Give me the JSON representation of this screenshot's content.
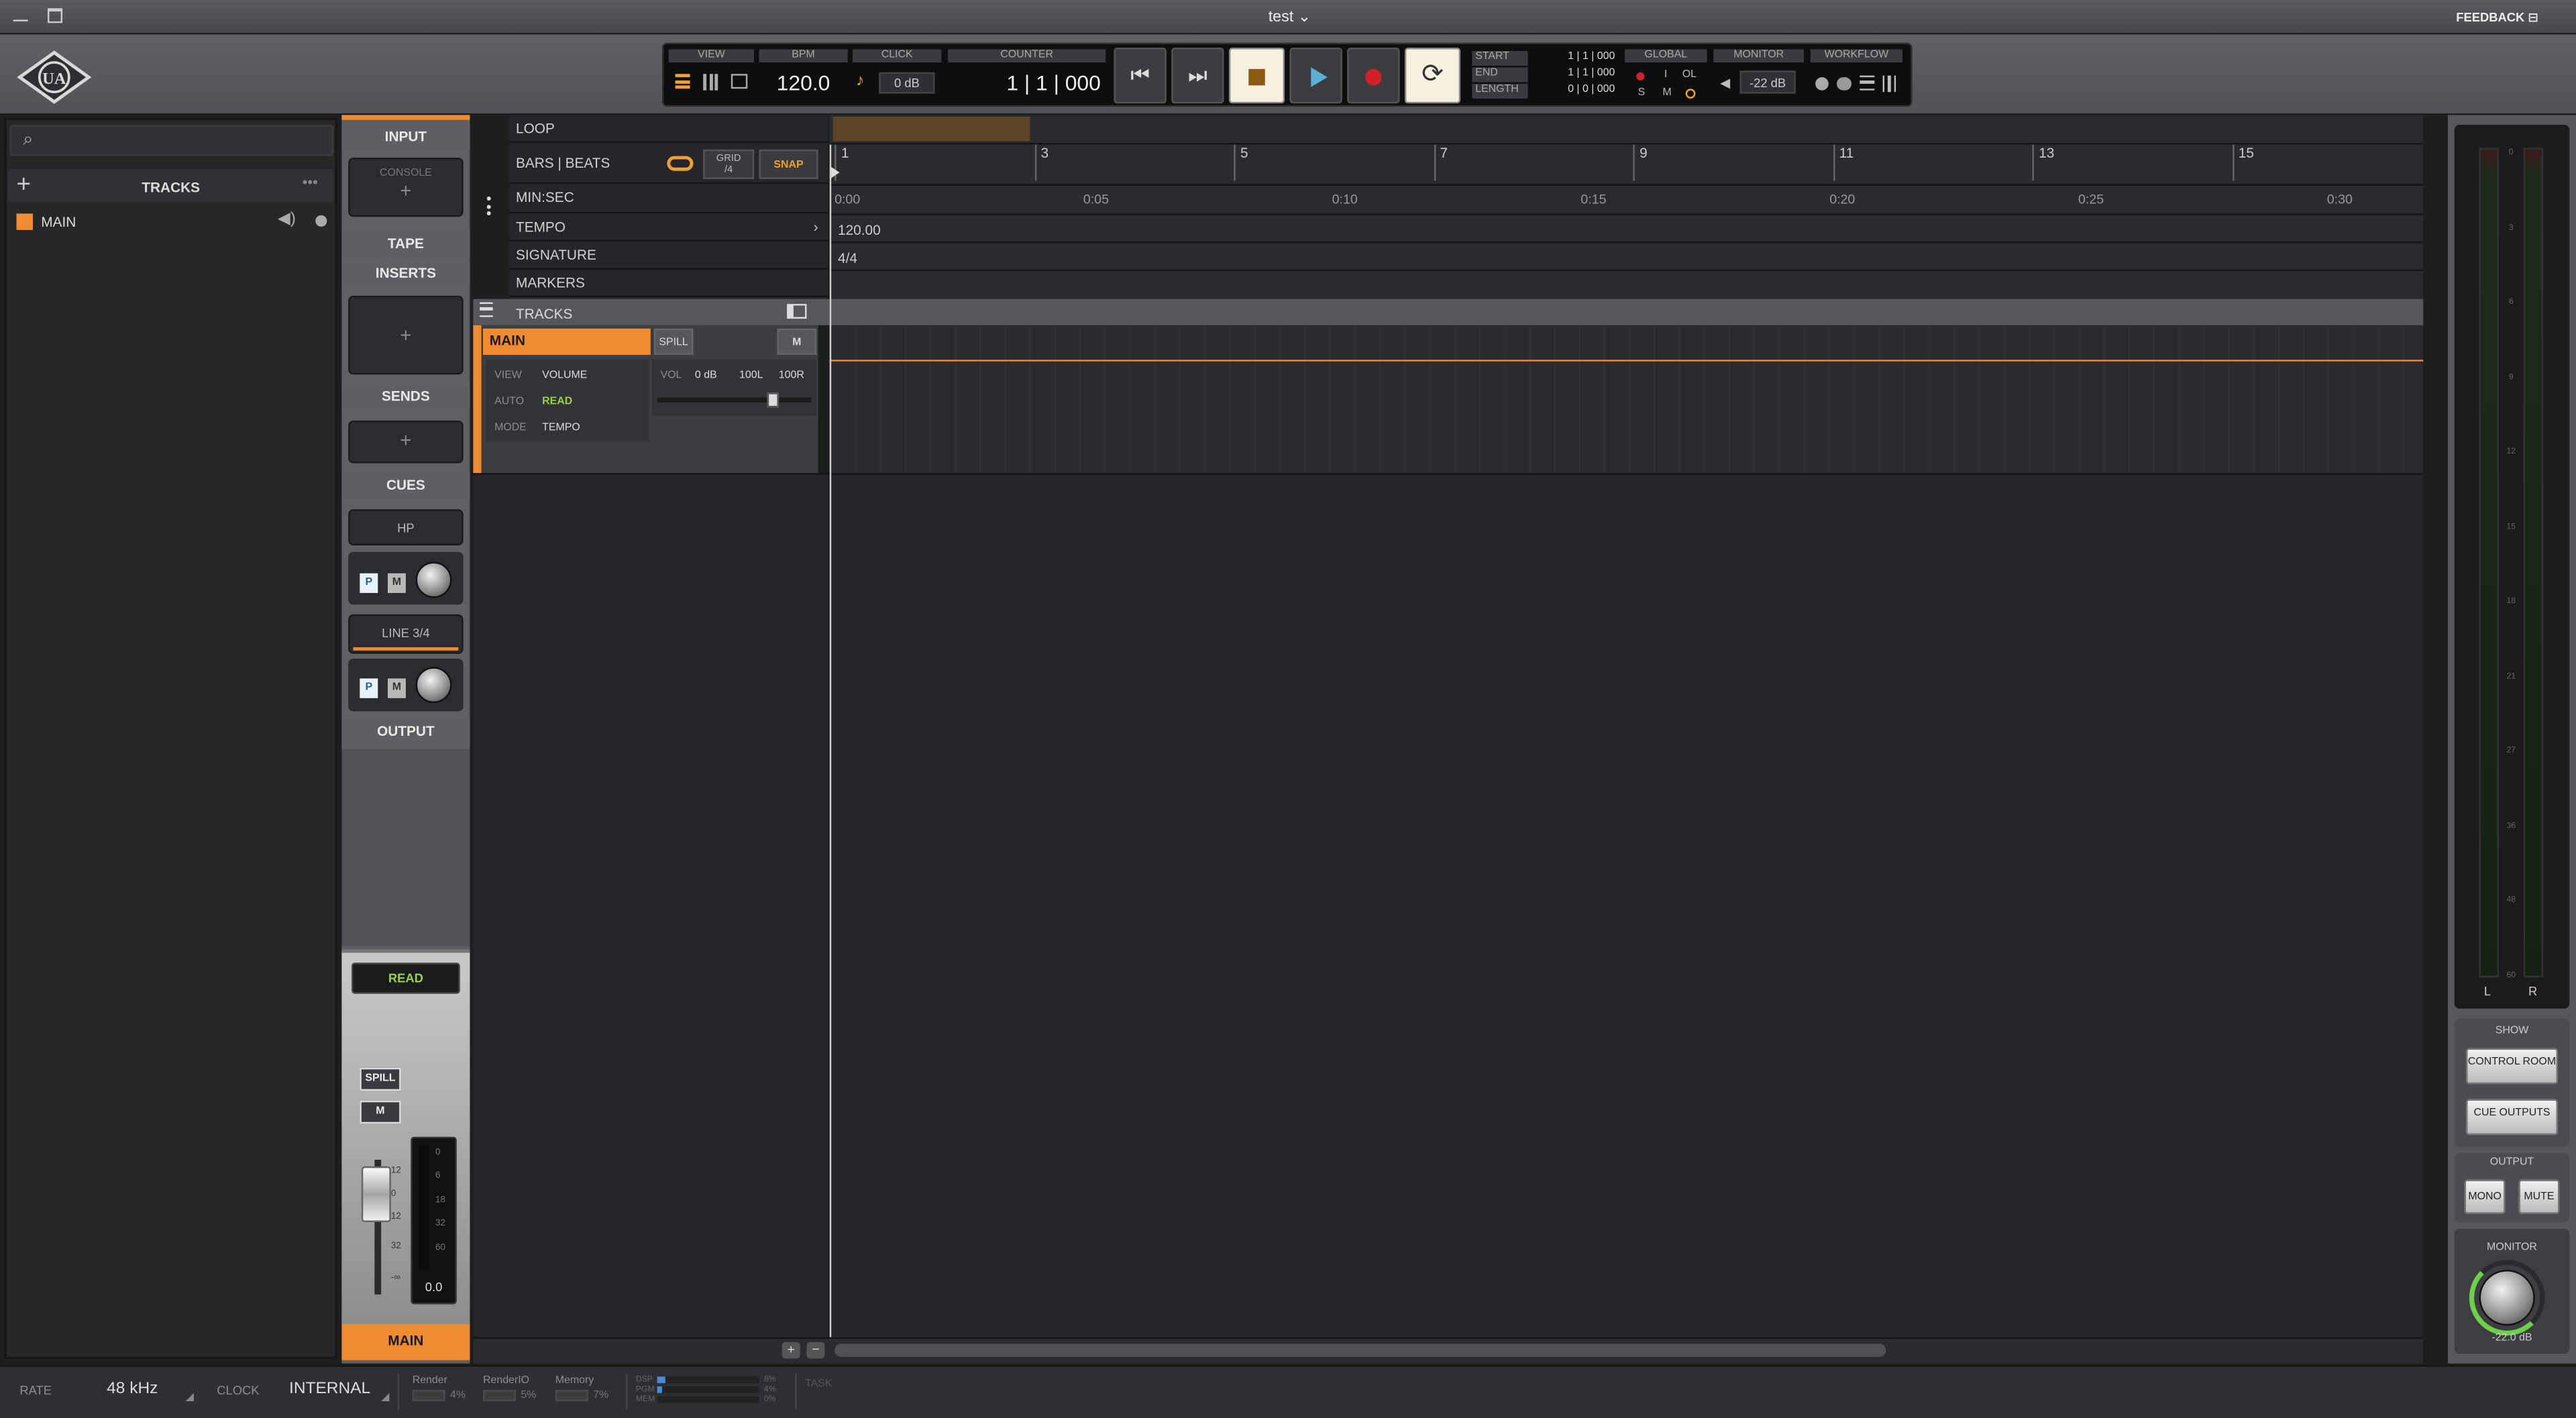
{
  "window": {
    "title": "test",
    "feedback": "FEEDBACK"
  },
  "colors": {
    "accent": "#f08a33",
    "green": "#9dd04a",
    "panel": "#5e6064"
  },
  "transport": {
    "view": "VIEW",
    "bpm_label": "BPM",
    "bpm": "120.0",
    "click_label": "CLICK",
    "click_value": "0 dB",
    "counter_label": "COUNTER",
    "counter": "1 | 1 | 000",
    "start_label": "START",
    "end_label": "END",
    "length_label": "LENGTH",
    "start": "1 | 1 | 000",
    "end": "1 | 1 | 000",
    "length": "0 | 0 | 000",
    "global_label": "GLOBAL",
    "global_i": "I",
    "global_ol": "OL",
    "global_s": "S",
    "global_m": "M",
    "monitor_label": "MONITOR",
    "monitor_value": "-22 dB",
    "workflow_label": "WORKFLOW"
  },
  "tracks_panel": {
    "header": "TRACKS",
    "items": [
      {
        "name": "MAIN"
      }
    ]
  },
  "channel_strip": {
    "input": "INPUT",
    "console": "CONSOLE",
    "tape": "TAPE",
    "inserts": "INSERTS",
    "sends": "SENDS",
    "cues": "CUES",
    "cue1": "HP",
    "cue2": "LINE 3/4",
    "p": "P",
    "m": "M",
    "output": "OUTPUT",
    "auto": "READ",
    "spill": "SPILL",
    "mute": "M",
    "fader_value": "0.0",
    "name": "MAIN",
    "scale": [
      "12",
      "0",
      "12",
      "32",
      "-∞"
    ],
    "meter_scale": [
      "0",
      "6",
      "18",
      "32",
      "60"
    ]
  },
  "rulers": {
    "loop": "LOOP",
    "bars_beats": "BARS | BEATS",
    "grid_label": "GRID",
    "grid_value": "/4",
    "snap": "SNAP",
    "min_sec": "MIN:SEC",
    "tempo": "TEMPO",
    "tempo_value": "120.00",
    "signature": "SIGNATURE",
    "signature_value": "4/4",
    "markers": "MARKERS",
    "tracks": "TRACKS",
    "bars": [
      "1",
      "3",
      "5",
      "7",
      "9",
      "11",
      "13",
      "15"
    ],
    "times": [
      "0:00",
      "0:05",
      "0:10",
      "0:15",
      "0:20",
      "0:25",
      "0:30"
    ]
  },
  "track": {
    "name": "MAIN",
    "spill": "SPILL",
    "mute": "M",
    "view_label": "VIEW",
    "view_value": "VOLUME",
    "auto_label": "AUTO",
    "auto_value": "READ",
    "mode_label": "MODE",
    "mode_value": "TEMPO",
    "vol_label": "VOL",
    "vol_value": "0 dB",
    "pan_l": "100L",
    "pan_r": "100R"
  },
  "right_panel": {
    "meter_scale": [
      "0",
      "3",
      "6",
      "9",
      "12",
      "15",
      "18",
      "21",
      "27",
      "36",
      "48",
      "60"
    ],
    "l": "L",
    "r": "R",
    "show": "SHOW",
    "control_room": "CONTROL ROOM",
    "cue_outputs": "CUE OUTPUTS",
    "output": "OUTPUT",
    "mono": "MONO",
    "mute": "MUTE",
    "monitor": "MONITOR",
    "monitor_value": "-22.0 dB"
  },
  "status": {
    "rate_label": "RATE",
    "rate": "48 kHz",
    "clock_label": "CLOCK",
    "clock": "INTERNAL",
    "render_label": "Render",
    "render": "4%",
    "renderio_label": "RenderIO",
    "renderio": "5%",
    "memory_label": "Memory",
    "memory": "7%",
    "dsp_label": "DSP",
    "pgm_label": "PGM",
    "mem_label": "MEM",
    "dsp": "8%",
    "pgm": "4%",
    "mem": "0%",
    "task": "TASK"
  }
}
